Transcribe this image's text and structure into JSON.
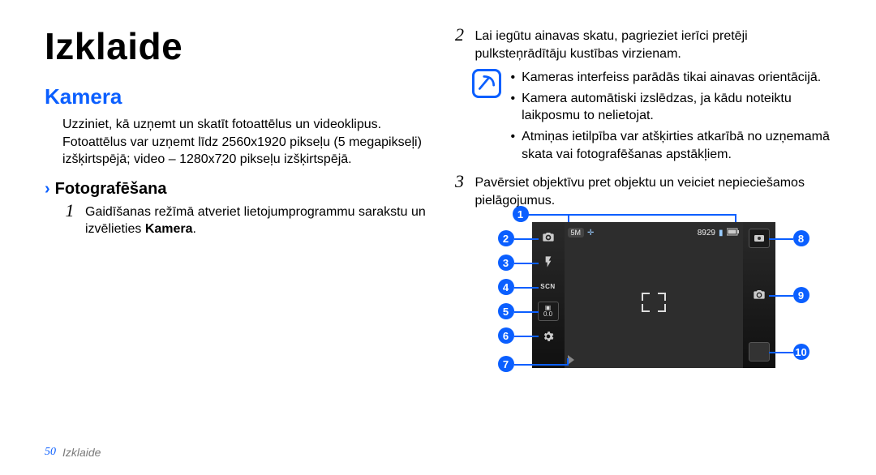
{
  "page": {
    "title": "Izklaide",
    "section": "Kamera",
    "intro": "Uzziniet, kā uzņemt un skatīt fotoattēlus un videoklipus. Fotoattēlus var uzņemt līdz 2560x1920 pikseļu (5 megapikseļi) izšķirtspējā; video – 1280x720 pikseļu izšķirtspējā.",
    "sub_heading": "Fotografēšana",
    "steps": {
      "s1_num": "1",
      "s1_a": "Gaidīšanas režīmā atveriet lietojumprogrammu sarakstu un izvēlieties ",
      "s1_b": "Kamera",
      "s1_c": ".",
      "s2_num": "2",
      "s2": "Lai iegūtu ainavas skatu, pagrieziet ierīci pretēji pulksteņrādītāju kustības virzienam.",
      "s3_num": "3",
      "s3": "Pavērsiet objektīvu pret objektu un veiciet nepieciešamos pielāgojumus."
    },
    "note_bullet": "•",
    "notes": {
      "n1": "Kameras interfeiss parādās tikai ainavas orientācijā.",
      "n2": "Kamera automātiski izslēdzas, ja kādu noteiktu laikposmu to nelietojat.",
      "n3": "Atmiņas ietilpība var atšķirties atkarībā no uzņemamā skata vai fotografēšanas apstākļiem."
    },
    "footer_page": "50",
    "footer_section": "Izklaide"
  },
  "callouts": {
    "c1": "1",
    "c2": "2",
    "c3": "3",
    "c4": "4",
    "c5": "5",
    "c6": "6",
    "c7": "7",
    "c8": "8",
    "c9": "9",
    "c10": "10"
  },
  "camera_ui": {
    "resolution_badge": "5M",
    "shots_remaining": "8929",
    "scn_label": "SCN",
    "ev_label": "0.0"
  },
  "colors": {
    "accent": "#0b5fff"
  }
}
